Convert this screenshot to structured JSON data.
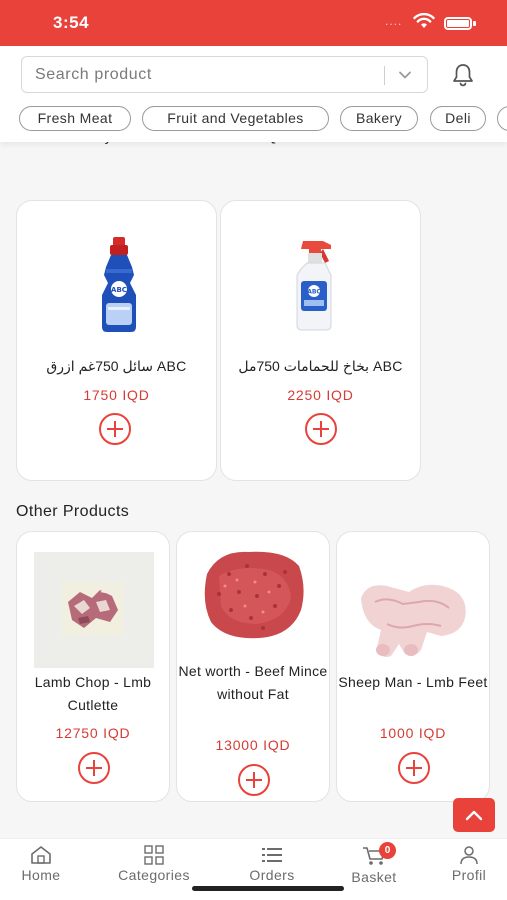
{
  "status_bar": {
    "time": "3:54",
    "signal": "....",
    "accent_color": "#e8423b"
  },
  "search": {
    "placeholder": "Search product"
  },
  "categories": [
    {
      "label": "Fresh Meat"
    },
    {
      "label": "Fruit and Vegetables"
    },
    {
      "label": "Bakery"
    },
    {
      "label": "Deli"
    }
  ],
  "cut_off_title": "Lamb Parsley - Lmb Cutlette for BBQ",
  "featured_products": [
    {
      "name": "سائل 750غم ازرق ABC",
      "price": "1750 IQD",
      "image": "dish-soap-bottle"
    },
    {
      "name": "بخاخ للحمامات 750مل ABC",
      "price": "2250 IQD",
      "image": "spray-bottle"
    }
  ],
  "other_section": {
    "title": "Other Products"
  },
  "other_products": [
    {
      "name": "Lamb Chop - Lmb Cutlette",
      "price": "12750 IQD",
      "image": "lamb-chop"
    },
    {
      "name": "Net worth - Beef Mince without Fat",
      "price": "13000 IQD",
      "image": "minced-beef"
    },
    {
      "name": "Sheep Man - Lmb Feet",
      "price": "1000 IQD",
      "image": "lamb-feet"
    }
  ],
  "nav": {
    "home": "Home",
    "categories": "Categories",
    "orders": "Orders",
    "basket": "Basket",
    "basket_count": "0",
    "profile": "Profil"
  }
}
